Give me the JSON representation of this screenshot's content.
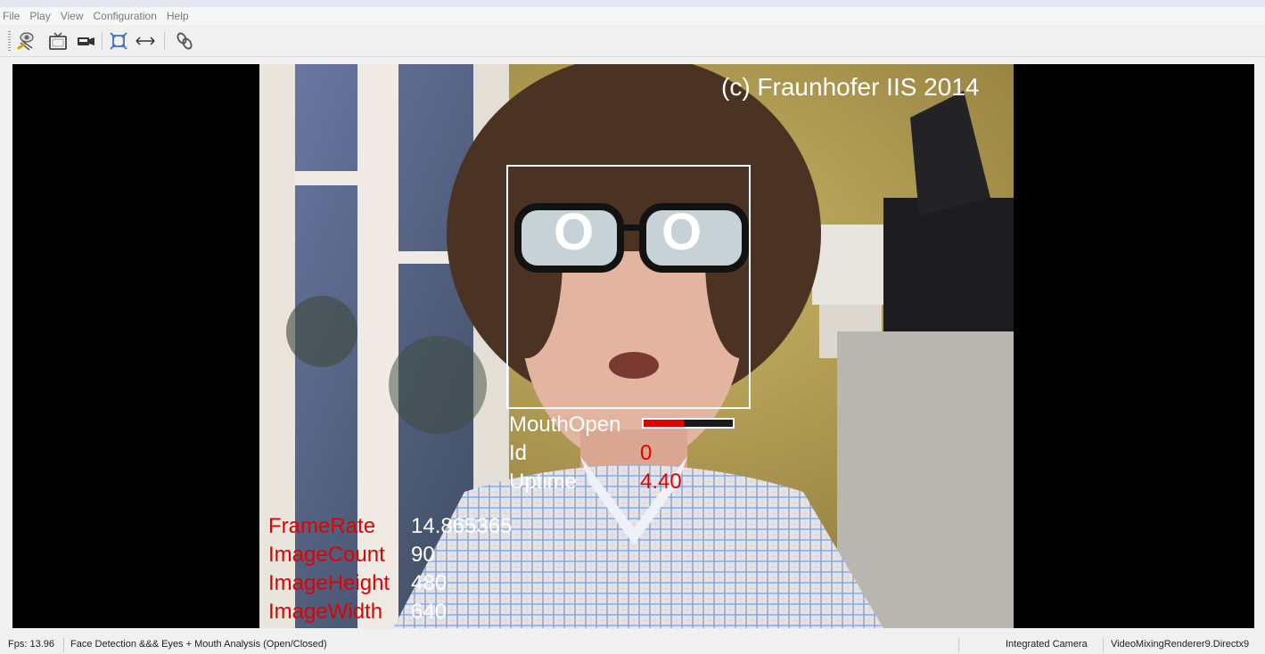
{
  "menu": {
    "items": [
      "File",
      "Play",
      "View",
      "Configuration",
      "Help"
    ]
  },
  "toolbar": {
    "icons": [
      "camera-settings-icon",
      "tv-icon",
      "video-camera-icon",
      "fit-window-icon",
      "stretch-horizontal-icon",
      "link-icon"
    ]
  },
  "video": {
    "copyright": "(c) Fraunhofer IIS 2014",
    "eyes": {
      "left": "O",
      "right": "O"
    },
    "face": {
      "mouth_label": "MouthOpen",
      "mouth_level": 0.45,
      "id_label": "Id",
      "id_value": "0",
      "uptime_label": "Uptime",
      "uptime_value": "4.40"
    },
    "stats": [
      {
        "label": "FrameRate",
        "value": "14.865365"
      },
      {
        "label": "ImageCount",
        "value": "90"
      },
      {
        "label": "ImageHeight",
        "value": "480"
      },
      {
        "label": "ImageWidth",
        "value": "640"
      }
    ]
  },
  "status": {
    "fps": "Fps: 13.96",
    "mode": "Face Detection &&& Eyes + Mouth Analysis (Open/Closed)",
    "camera": "Integrated Camera",
    "renderer": "VideoMixingRenderer9.Directx9"
  },
  "colors": {
    "overlay_red": "#e30000",
    "overlay_white": "#ffffff"
  }
}
